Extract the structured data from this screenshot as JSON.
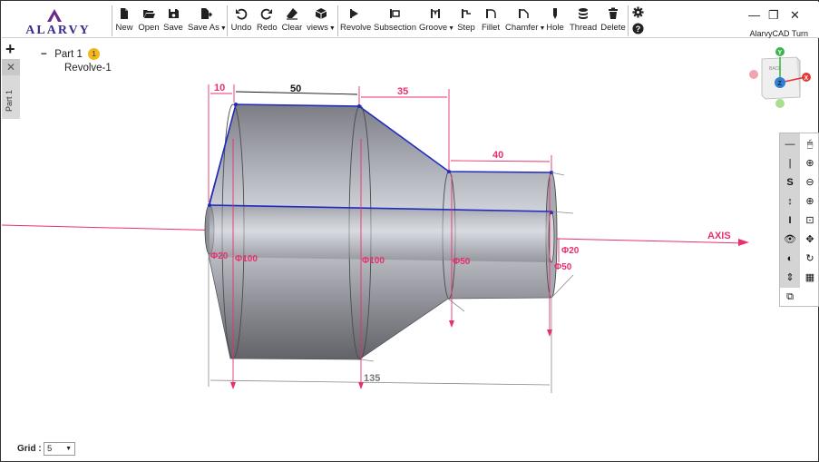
{
  "app": {
    "logo_text": "ALARVY",
    "title": "AlarvyCAD Turn"
  },
  "toolbar": {
    "file": [
      {
        "name": "new-button",
        "label": "New",
        "icon": "file-icon"
      },
      {
        "name": "open-button",
        "label": "Open",
        "icon": "folder-open-icon"
      },
      {
        "name": "save-button",
        "label": "Save",
        "icon": "floppy-icon"
      },
      {
        "name": "save-as-button",
        "label": "Save As",
        "icon": "file-export-icon",
        "has_menu": true
      }
    ],
    "edit": [
      {
        "name": "undo-button",
        "label": "Undo",
        "icon": "undo-icon"
      },
      {
        "name": "redo-button",
        "label": "Redo",
        "icon": "redo-icon"
      },
      {
        "name": "clear-button",
        "label": "Clear",
        "icon": "eraser-icon"
      },
      {
        "name": "views-button",
        "label": "views",
        "icon": "cube-icon",
        "has_menu": true
      }
    ],
    "features": [
      {
        "name": "revolve-button",
        "label": "Revolve",
        "icon": "revolve-icon"
      },
      {
        "name": "subsection-button",
        "label": "Subsection",
        "icon": "subsection-icon"
      },
      {
        "name": "groove-button",
        "label": "Groove",
        "icon": "groove-icon",
        "has_menu": true
      },
      {
        "name": "step-button",
        "label": "Step",
        "icon": "step-icon"
      },
      {
        "name": "fillet-button",
        "label": "Fillet",
        "icon": "fillet-icon"
      },
      {
        "name": "chamfer-button",
        "label": "Chamfer",
        "icon": "chamfer-icon",
        "has_menu": true
      },
      {
        "name": "hole-button",
        "label": "Hole",
        "icon": "hole-icon"
      },
      {
        "name": "thread-button",
        "label": "Thread",
        "icon": "database-icon"
      },
      {
        "name": "delete-button",
        "label": "Delete",
        "icon": "trash-icon"
      }
    ]
  },
  "window_controls": {
    "minimize": "—",
    "restore": "❐",
    "close": "✕"
  },
  "tabs": {
    "add": "+",
    "close": "✕",
    "part_tab_label": "Part 1"
  },
  "tree": {
    "root_toggle": "−",
    "root_label": "Part 1",
    "root_badge": "1",
    "child_label": "Revolve-1"
  },
  "view_cube": {
    "face_label": "BACK",
    "axis_y": "Y",
    "axis_x": "X",
    "axis_z": "Z"
  },
  "dimensions": {
    "top": [
      "10",
      "50",
      "35",
      "40"
    ],
    "overall": "135",
    "diameters": {
      "left_small": "Φ20",
      "first": "Φ100",
      "second": "Φ100",
      "third": "Φ50",
      "right_small": "Φ20",
      "right_large": "Φ50"
    },
    "axis_label": "AXIS"
  },
  "right_toolbar": {
    "left_col": [
      {
        "name": "line-tool",
        "label": "—"
      },
      {
        "name": "vertical-line-tool",
        "label": "|"
      },
      {
        "name": "s-tool",
        "label": "S"
      },
      {
        "name": "vertical-arrow-tool",
        "label": "↕"
      },
      {
        "name": "i-beam-tool",
        "label": "I"
      },
      {
        "name": "eye-icon",
        "label": "👁"
      },
      {
        "name": "contrast-icon",
        "label": "◐"
      },
      {
        "name": "sort-icon",
        "label": "⇕"
      }
    ],
    "right_col": [
      {
        "name": "mouse-icon",
        "label": "🖱"
      },
      {
        "name": "zoom-in-icon",
        "label": "⊕"
      },
      {
        "name": "zoom-out-icon",
        "label": "⊖"
      },
      {
        "name": "zoom-fit-icon",
        "label": "⊕"
      },
      {
        "name": "zoom-window-icon",
        "label": "⊡"
      },
      {
        "name": "pan-icon",
        "label": "✥"
      },
      {
        "name": "rotate-icon",
        "label": "↻"
      },
      {
        "name": "grid-icon",
        "label": "▦"
      }
    ],
    "bottom": {
      "name": "copy-view-icon",
      "label": "⧉"
    }
  },
  "grid": {
    "label": "Grid :",
    "value": "5"
  },
  "colors": {
    "dimension": "#e8306a",
    "edge": "#1f2bbf",
    "body_light": "#c9cbd4",
    "body_dark": "#6a6b72",
    "toolbar_strip": "#d4d4d4",
    "badge": "#f2b91c"
  }
}
